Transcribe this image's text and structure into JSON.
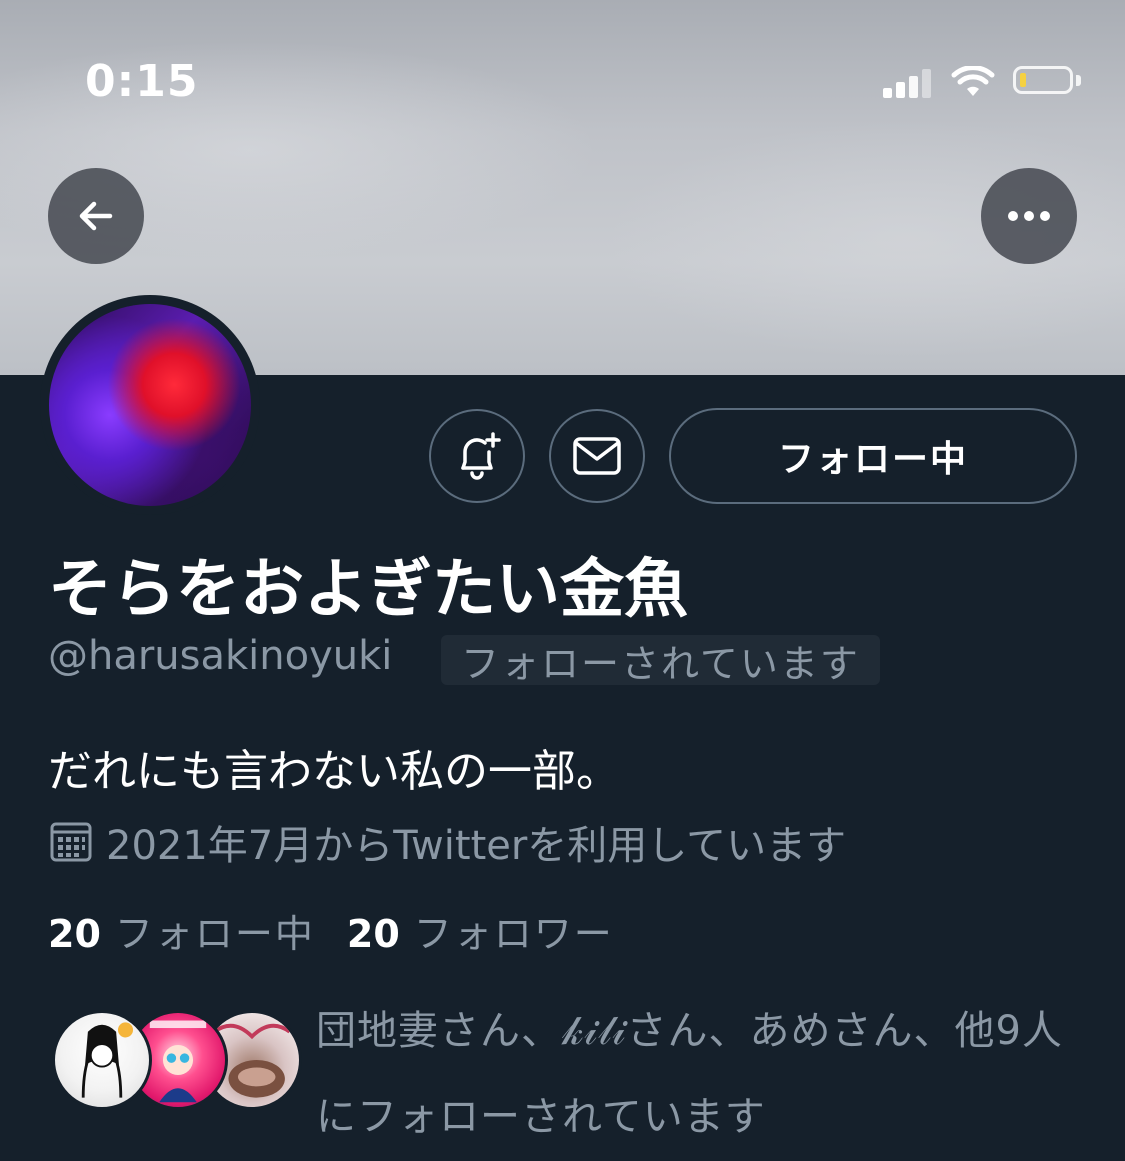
{
  "status_bar": {
    "time": "0:15"
  },
  "header": {
    "back_icon": "arrow-left-icon",
    "more_icon": "more-horizontal-icon"
  },
  "profile": {
    "display_name": "そらをおよぎたい金魚",
    "handle": "@harusakinoyuki",
    "follows_you": "フォローされています",
    "bio": "だれにも言わない私の一部。",
    "joined": "2021年7月からTwitterを利用しています",
    "following_count": "20",
    "following_label": "フォロー中",
    "followers_count": "20",
    "followers_label": "フォロワー"
  },
  "actions": {
    "notify_icon": "bell-plus-icon",
    "dm_icon": "mail-icon",
    "following_button": "フォロー中"
  },
  "mutuals": {
    "text": "団地妻さん、𝓀𝒾𝓁𝒾さん、あめさん、他9人にフォローされています"
  },
  "colors": {
    "background": "#15202b",
    "secondary_text": "#8b98a5",
    "button_border": "#5b6c7d",
    "badge_bg": "#202b36"
  }
}
